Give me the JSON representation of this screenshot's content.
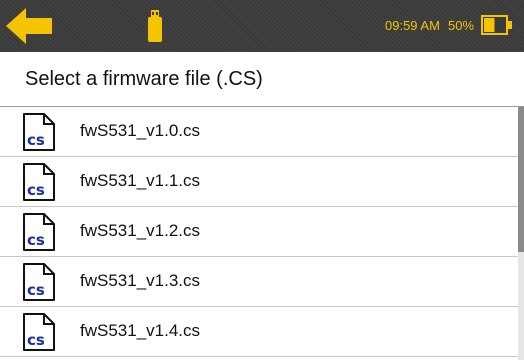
{
  "status_bar": {
    "time": "09:59 AM",
    "battery_percent": "50%",
    "battery_level": 0.5,
    "accent_color": "#f5c400"
  },
  "header": {
    "title": "Select a firmware file (.CS)"
  },
  "file_icon": {
    "icon_name": "cs-file-icon",
    "label": "cs",
    "label_color": "#1a2fa0"
  },
  "files": [
    {
      "name": "fwS531_v1.0.cs"
    },
    {
      "name": "fwS531_v1.1.cs"
    },
    {
      "name": "fwS531_v1.2.cs"
    },
    {
      "name": "fwS531_v1.3.cs"
    },
    {
      "name": "fwS531_v1.4.cs"
    }
  ]
}
